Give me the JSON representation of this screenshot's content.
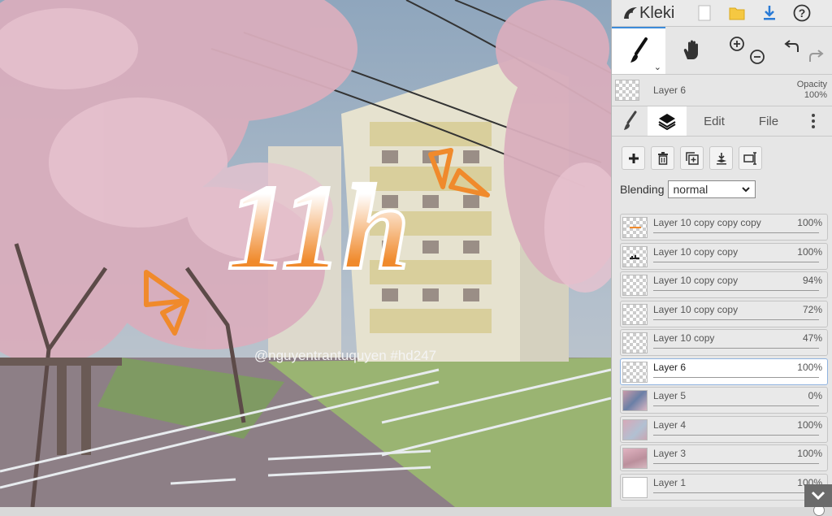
{
  "app": {
    "name": "Kleki"
  },
  "canvas": {
    "title_text": "11h",
    "watermark": "@nguyentrantuquyen  #hd247",
    "accent": "#f08a2c"
  },
  "topbar": {
    "icons": [
      "new-image-icon",
      "open-folder-icon",
      "download-icon",
      "help-icon"
    ]
  },
  "tools": {
    "brush": "brush-icon",
    "hand": "hand-icon",
    "zoom_in": "zoom-in-icon",
    "zoom_out": "zoom-out-icon",
    "undo": "undo-icon",
    "redo": "redo-icon"
  },
  "current_layer": {
    "name": "Layer 6",
    "opacity_label": "Opacity",
    "opacity_value": "100%"
  },
  "tabs": {
    "edit": "Edit",
    "file": "File"
  },
  "blending": {
    "label": "Blending",
    "value": "normal"
  },
  "layers": [
    {
      "name": "Layer 10 copy copy copy",
      "opacity": "100%",
      "value": 1.0,
      "thumb": "orange",
      "selected": false
    },
    {
      "name": "Layer 10 copy copy",
      "opacity": "100%",
      "value": 1.0,
      "thumb": "dark",
      "selected": false
    },
    {
      "name": "Layer 10 copy copy",
      "opacity": "94%",
      "value": 0.94,
      "thumb": "empty",
      "selected": false
    },
    {
      "name": "Layer 10 copy copy",
      "opacity": "72%",
      "value": 0.72,
      "thumb": "empty",
      "selected": false
    },
    {
      "name": "Layer 10 copy",
      "opacity": "47%",
      "value": 0.47,
      "thumb": "empty",
      "selected": false
    },
    {
      "name": "Layer 6",
      "opacity": "100%",
      "value": 1.0,
      "thumb": "empty",
      "selected": true
    },
    {
      "name": "Layer 5",
      "opacity": "0%",
      "value": 0.0,
      "thumb": "photo",
      "selected": false
    },
    {
      "name": "Layer 4",
      "opacity": "100%",
      "value": 1.0,
      "thumb": "photo2",
      "selected": false
    },
    {
      "name": "Layer 3",
      "opacity": "100%",
      "value": 1.0,
      "thumb": "photo3",
      "selected": false
    },
    {
      "name": "Layer 1",
      "opacity": "100%",
      "value": 1.0,
      "thumb": "white",
      "selected": false
    }
  ]
}
